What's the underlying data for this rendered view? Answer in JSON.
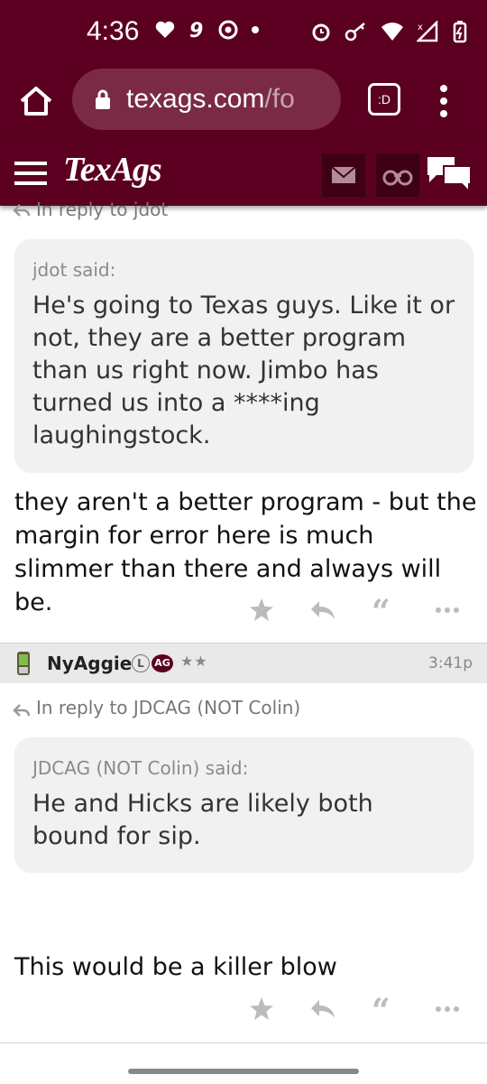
{
  "status_bar": {
    "time": "4:36"
  },
  "browser": {
    "url_main": "texags.com",
    "url_dim": "/fo",
    "tab_label": ":D"
  },
  "site": {
    "logo": "TexAgs"
  },
  "post1": {
    "reply_to_clipped": "In reply to jdot",
    "quote_author": "jdot said:",
    "quote_text": "He's going to Texas guys. Like it or not, they are a better program than us right now. Jimbo has turned us into a ****ing laughingstock.",
    "text": "they aren't a better program - but the margin for error here is much slimmer than there and always will be."
  },
  "post2": {
    "username": "NyAggie",
    "badge_l": "L",
    "badge_ag": "AG",
    "stars": "★★",
    "time": "3:41p",
    "reply_to": "In reply to JDCAG (NOT Colin)",
    "quote_author": "JDCAG (NOT Colin) said:",
    "quote_text": "He and Hicks are likely both bound for sip.",
    "text": "This would be a killer blow"
  },
  "colors": {
    "brand": "#5b0020",
    "icon_box": "#3e0016"
  },
  "icons": [
    "home-icon",
    "lock-icon",
    "menu-dots-icon",
    "hamburger-icon",
    "mail-icon",
    "binoculars-icon",
    "chat-icon",
    "star-icon",
    "reply-icon",
    "quote-icon",
    "more-icon",
    "phone-icon"
  ]
}
